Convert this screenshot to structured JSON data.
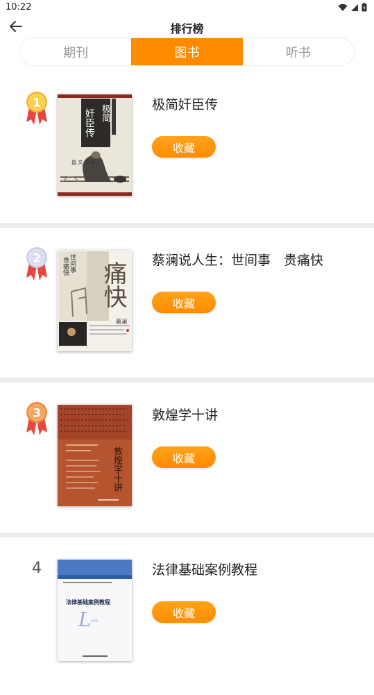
{
  "status": {
    "time": "10:22"
  },
  "header": {
    "title": "排行榜"
  },
  "tabs": [
    {
      "label": "期刊",
      "active": false
    },
    {
      "label": "图书",
      "active": true
    },
    {
      "label": "听书",
      "active": false
    }
  ],
  "colors": {
    "accent": "#ff8a00",
    "divider": "#ececec"
  },
  "books": [
    {
      "rank": "1",
      "title": "极简奸臣传",
      "button": "收藏",
      "cover": {
        "vertical_title_1": "极简",
        "vertical_title_2": "奸臣传"
      }
    },
    {
      "rank": "2",
      "title": "蔡澜说人生：世间事　贵痛快",
      "button": "收藏",
      "cover": {
        "vertical_title_1": "世间事",
        "vertical_title_2": "贵痛快",
        "big_text": "痛快",
        "author": "蔡澜"
      }
    },
    {
      "rank": "3",
      "title": "敦煌学十讲",
      "button": "收藏",
      "cover": {
        "vertical_title": "敦煌学十讲"
      }
    },
    {
      "rank": "4",
      "title": "法律基础案例教程",
      "button": "收藏",
      "cover": {
        "title": "法律基础案例教程"
      }
    }
  ]
}
